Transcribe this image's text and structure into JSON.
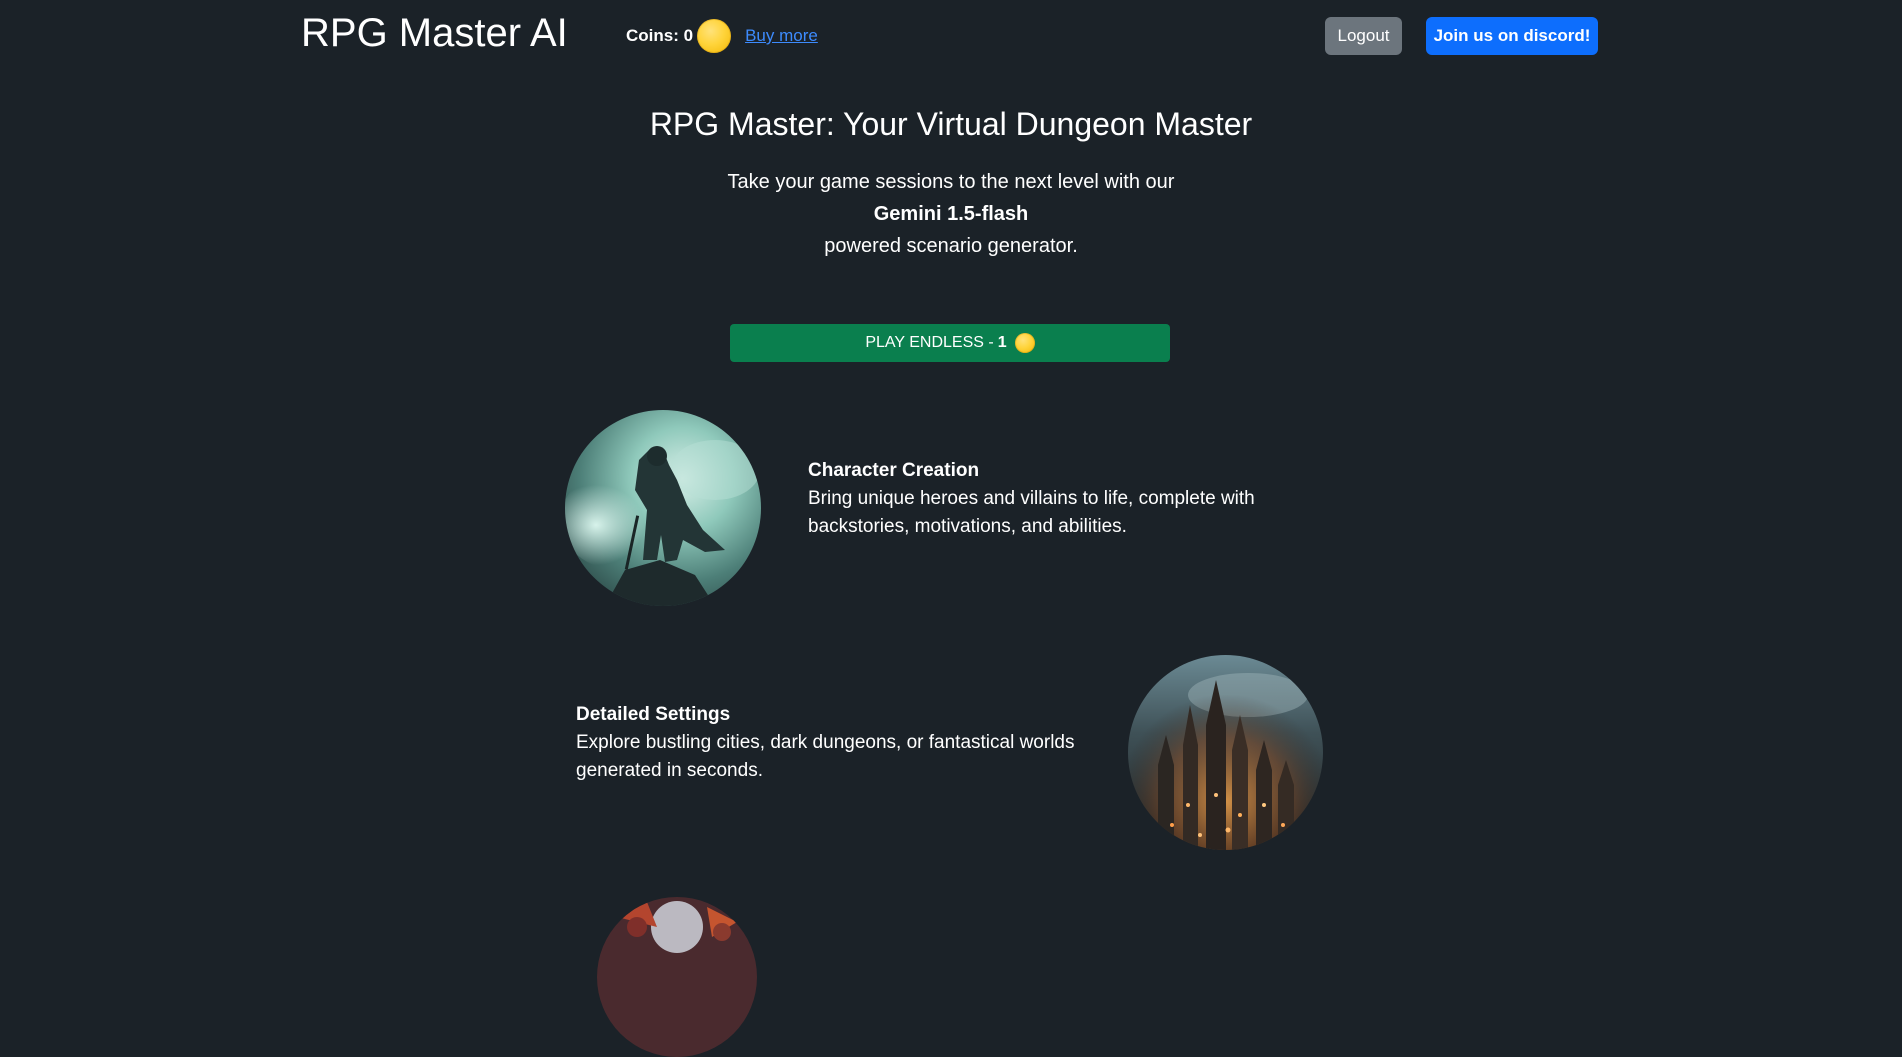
{
  "navbar": {
    "brand": "RPG Master AI",
    "coins_label": "Coins: 0",
    "buy_more": "Buy more",
    "logout": "Logout",
    "discord": "Join us on discord!"
  },
  "hero": {
    "title": "RPG Master: Your Virtual Dungeon Master",
    "line1": "Take your game sessions to the next level with our",
    "model": "Gemini 1.5-flash",
    "line3": "powered scenario generator."
  },
  "play_button": {
    "label": "PLAY ENDLESS -",
    "cost": "1"
  },
  "features": [
    {
      "title": "Character Creation",
      "description": "Bring unique heroes and villains to life, complete with backstories, motivations, and abilities.",
      "image": "hooded-warrior-portrait"
    },
    {
      "title": "Detailed Settings",
      "description": "Explore bustling cities, dark dungeons, or fantastical worlds generated in seconds.",
      "image": "fantasy-city-portrait"
    },
    {
      "image": "creature-portrait"
    }
  ],
  "colors": {
    "background": "#1b2228",
    "play_button": "#0a7f4e",
    "discord_button": "#0d6efd",
    "logout_button": "#6c757d",
    "link": "#3d8bfd",
    "coin": "#ffd43b"
  },
  "icons": {
    "coin": "coin-icon"
  }
}
